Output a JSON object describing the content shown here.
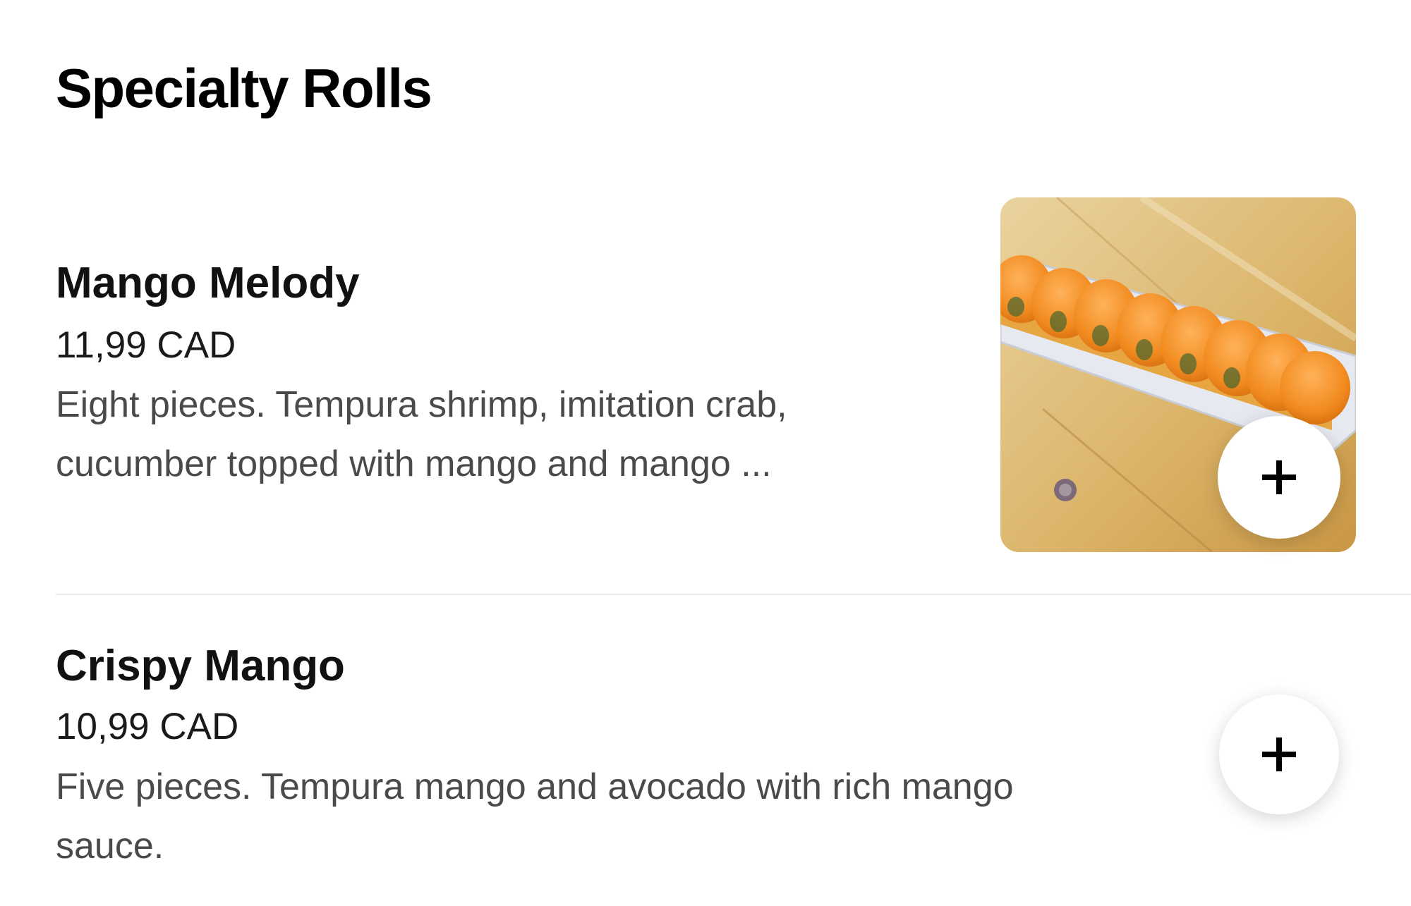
{
  "section": {
    "title": "Specialty Rolls"
  },
  "items": [
    {
      "name": "Mango Melody",
      "price": "11,99 CAD",
      "description_line1": "Eight pieces. Tempura shrimp, imitation crab,",
      "description_line2": "cucumber topped with mango and mango ...",
      "add_icon": "plus-icon"
    },
    {
      "name": "Crispy Mango",
      "price": "10,99 CAD",
      "description_line1": "Five pieces. Tempura mango and avocado with rich mango",
      "description_line2": "sauce.",
      "add_icon": "plus-icon"
    }
  ],
  "colors": {
    "accent": "#000000",
    "muted_text": "#4a4a4a",
    "divider": "#ececec"
  }
}
